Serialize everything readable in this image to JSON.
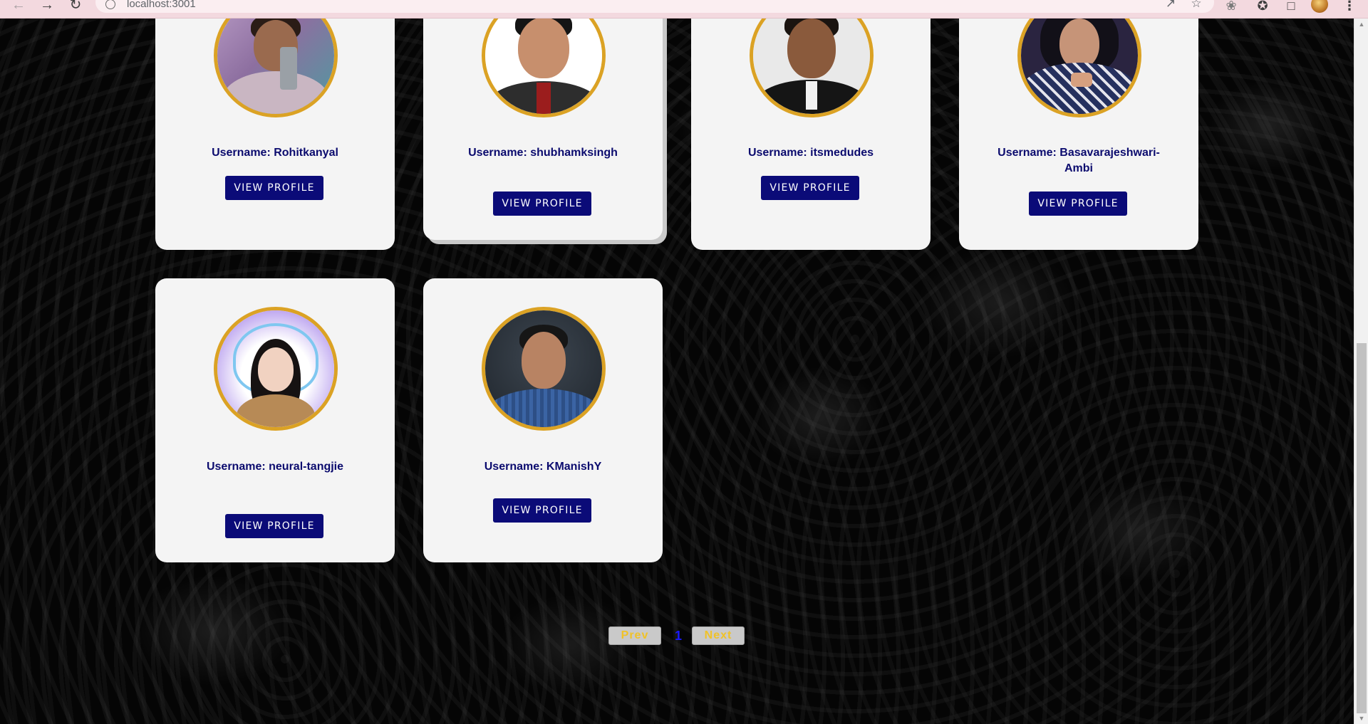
{
  "browser": {
    "url": "localhost:3001",
    "back_icon": "back-arrow-icon",
    "forward_icon": "forward-arrow-icon",
    "reload_icon": "reload-icon"
  },
  "cards": [
    {
      "username": "Username: Rohitkanyal",
      "button": "VIEW PROFILE"
    },
    {
      "username": "Username: shubhamksingh",
      "button": "VIEW PROFILE"
    },
    {
      "username": "Username: itsmedudes",
      "button": "VIEW PROFILE"
    },
    {
      "username": "Username: Basavarajeshwari-Ambi",
      "button": "VIEW PROFILE"
    },
    {
      "username": "Username: neural-tangjie",
      "button": "VIEW PROFILE"
    },
    {
      "username": "Username: KManishY",
      "button": "VIEW PROFILE"
    }
  ],
  "pagination": {
    "prev_label": "Prev",
    "current_page": "1",
    "next_label": "Next"
  },
  "colors": {
    "card_bg": "#f4f4f4",
    "button_bg": "#0b0b78",
    "avatar_border": "#dba224",
    "username_text": "#0b0b6e",
    "pager_text": "#f0c227",
    "page_number": "#1a1aff"
  }
}
